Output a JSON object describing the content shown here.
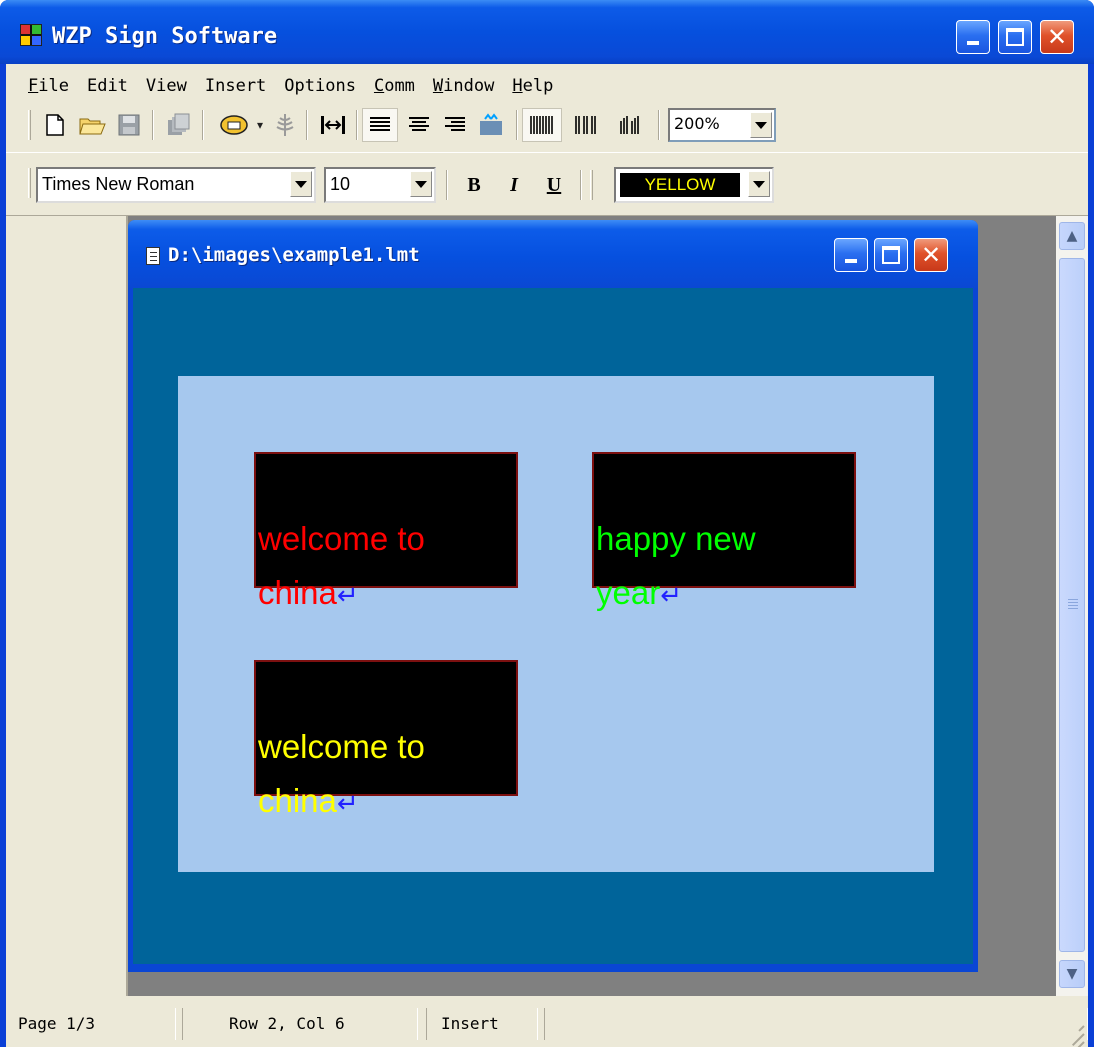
{
  "app": {
    "title": "WZP Sign Software",
    "window_buttons": [
      "minimize",
      "maximize",
      "close"
    ]
  },
  "menubar": {
    "items": [
      {
        "accel": "F",
        "rest": "ile"
      },
      {
        "accel": "",
        "rest": "Edit"
      },
      {
        "accel": "",
        "rest": "View"
      },
      {
        "accel": "",
        "rest": "Insert"
      },
      {
        "accel": "",
        "rest": "Options"
      },
      {
        "accel": "C",
        "rest": "omm"
      },
      {
        "accel": "W",
        "rest": "indow"
      },
      {
        "accel": "H",
        "rest": "elp"
      }
    ]
  },
  "toolbar": {
    "icons": [
      "new-file-icon",
      "open-folder-icon",
      "save-icon",
      "copy-icon",
      "phone-icon",
      "dropdown-arrow-icon",
      "antenna-icon",
      "fit-width-icon",
      "align-left-icon",
      "align-center-icon",
      "align-right-icon",
      "fill-icon",
      "bars-wide-icon",
      "bars-medium-icon",
      "bars-narrow-icon"
    ],
    "zoom": "200%"
  },
  "format_bar": {
    "font_name": "Times New Roman",
    "font_size": "10",
    "bold_label": "B",
    "italic_label": "I",
    "underline_label": "U",
    "color_label": "YELLOW",
    "color_value": "#ffff00"
  },
  "document": {
    "title": "D:\\images\\example1.lmt",
    "signs": [
      {
        "line1": "welcome to",
        "line2": "china",
        "color": "#ff0000"
      },
      {
        "line1": "happy new",
        "line2": "year",
        "color": "#00ff00"
      },
      {
        "line1": "welcome to",
        "line2": "china",
        "color": "#ffff00"
      }
    ],
    "return_glyph": "↵"
  },
  "status": {
    "page": "Page 1/3",
    "position": "Row 2, Col 6",
    "mode": "Insert"
  }
}
